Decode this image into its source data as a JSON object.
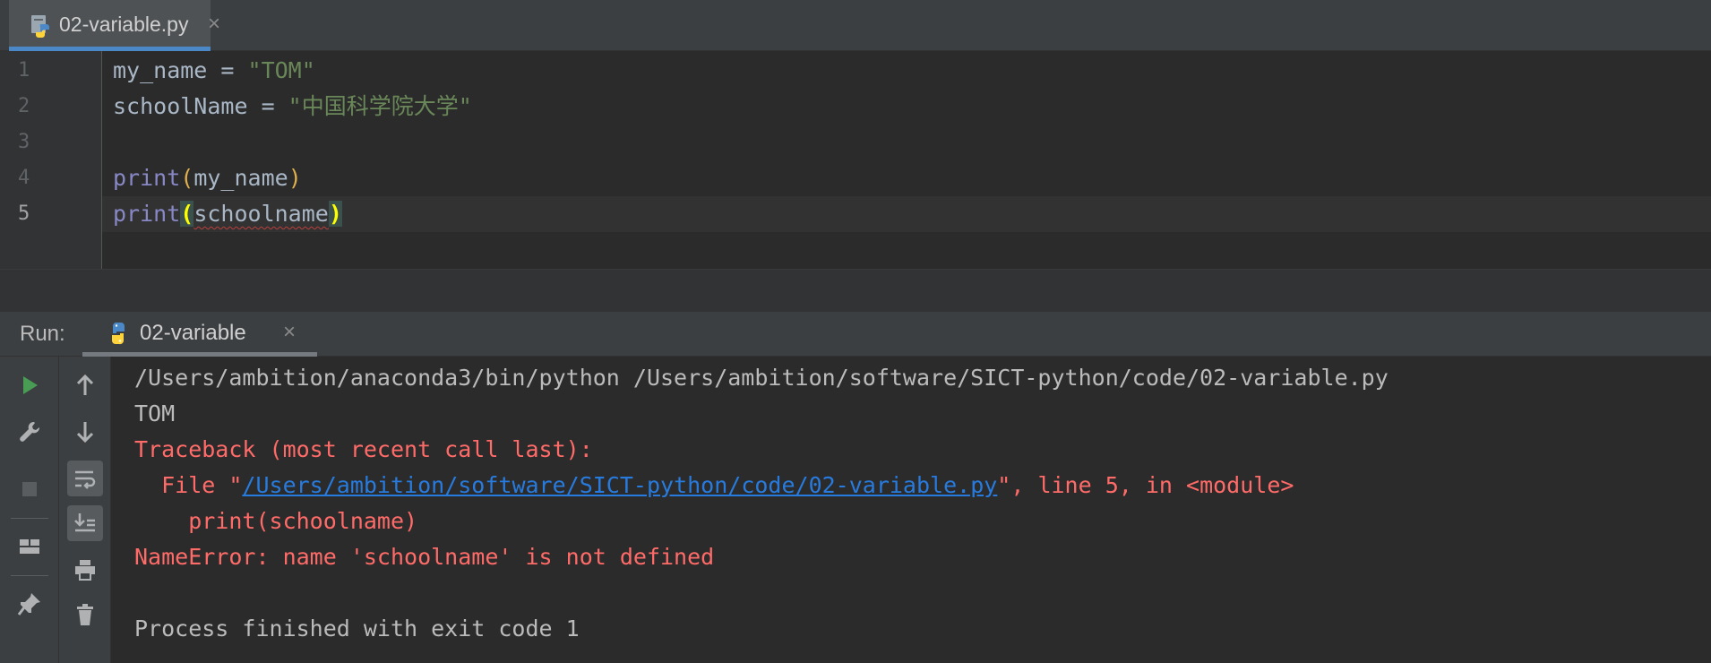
{
  "editor_tab": {
    "filename": "02-variable.py",
    "close": "×"
  },
  "editor": {
    "line_numbers": [
      "1",
      "2",
      "3",
      "4",
      "5"
    ],
    "lines": {
      "l1": {
        "var": "my_name",
        "op": " = ",
        "str": "\"TOM\""
      },
      "l2": {
        "var": "schoolName",
        "op": " = ",
        "str": "\"中国科学院大学\""
      },
      "l4": {
        "fn": "print",
        "open": "(",
        "arg": "my_name",
        "close": ")"
      },
      "l5": {
        "fn": "print",
        "open": "(",
        "arg": "schoolname",
        "close": ")"
      }
    }
  },
  "run": {
    "label": "Run:",
    "tab_name": "02-variable",
    "close": "×"
  },
  "console": {
    "command": "/Users/ambition/anaconda3/bin/python /Users/ambition/software/SICT-python/code/02-variable.py",
    "output": "TOM",
    "traceback_header": "Traceback (most recent call last):",
    "file_prefix": "  File \"",
    "file_path": "/Users/ambition/software/SICT-python/code/02-variable.py",
    "file_suffix": "\", line 5, in <module>",
    "code_line": "    print(schoolname)",
    "error": "NameError: name 'schoolname' is not defined",
    "exit": "Process finished with exit code 1"
  },
  "colors": {
    "background": "#2b2b2b",
    "panel": "#3c3f41",
    "string": "#6a8759",
    "builtin": "#8888c6",
    "error": "#ff6b68",
    "link": "#287bde",
    "run_green": "#499c54"
  },
  "icons": {
    "file_tab": "python-file-icon",
    "run_tab": "python-icon",
    "toolbar_left": [
      "run-icon",
      "wrench-icon",
      "stop-icon",
      "layout-icon",
      "pin-icon"
    ],
    "toolbar_right": [
      "arrow-up-icon",
      "arrow-down-icon",
      "soft-wrap-icon",
      "scroll-to-end-icon",
      "print-icon",
      "trash-icon"
    ]
  }
}
